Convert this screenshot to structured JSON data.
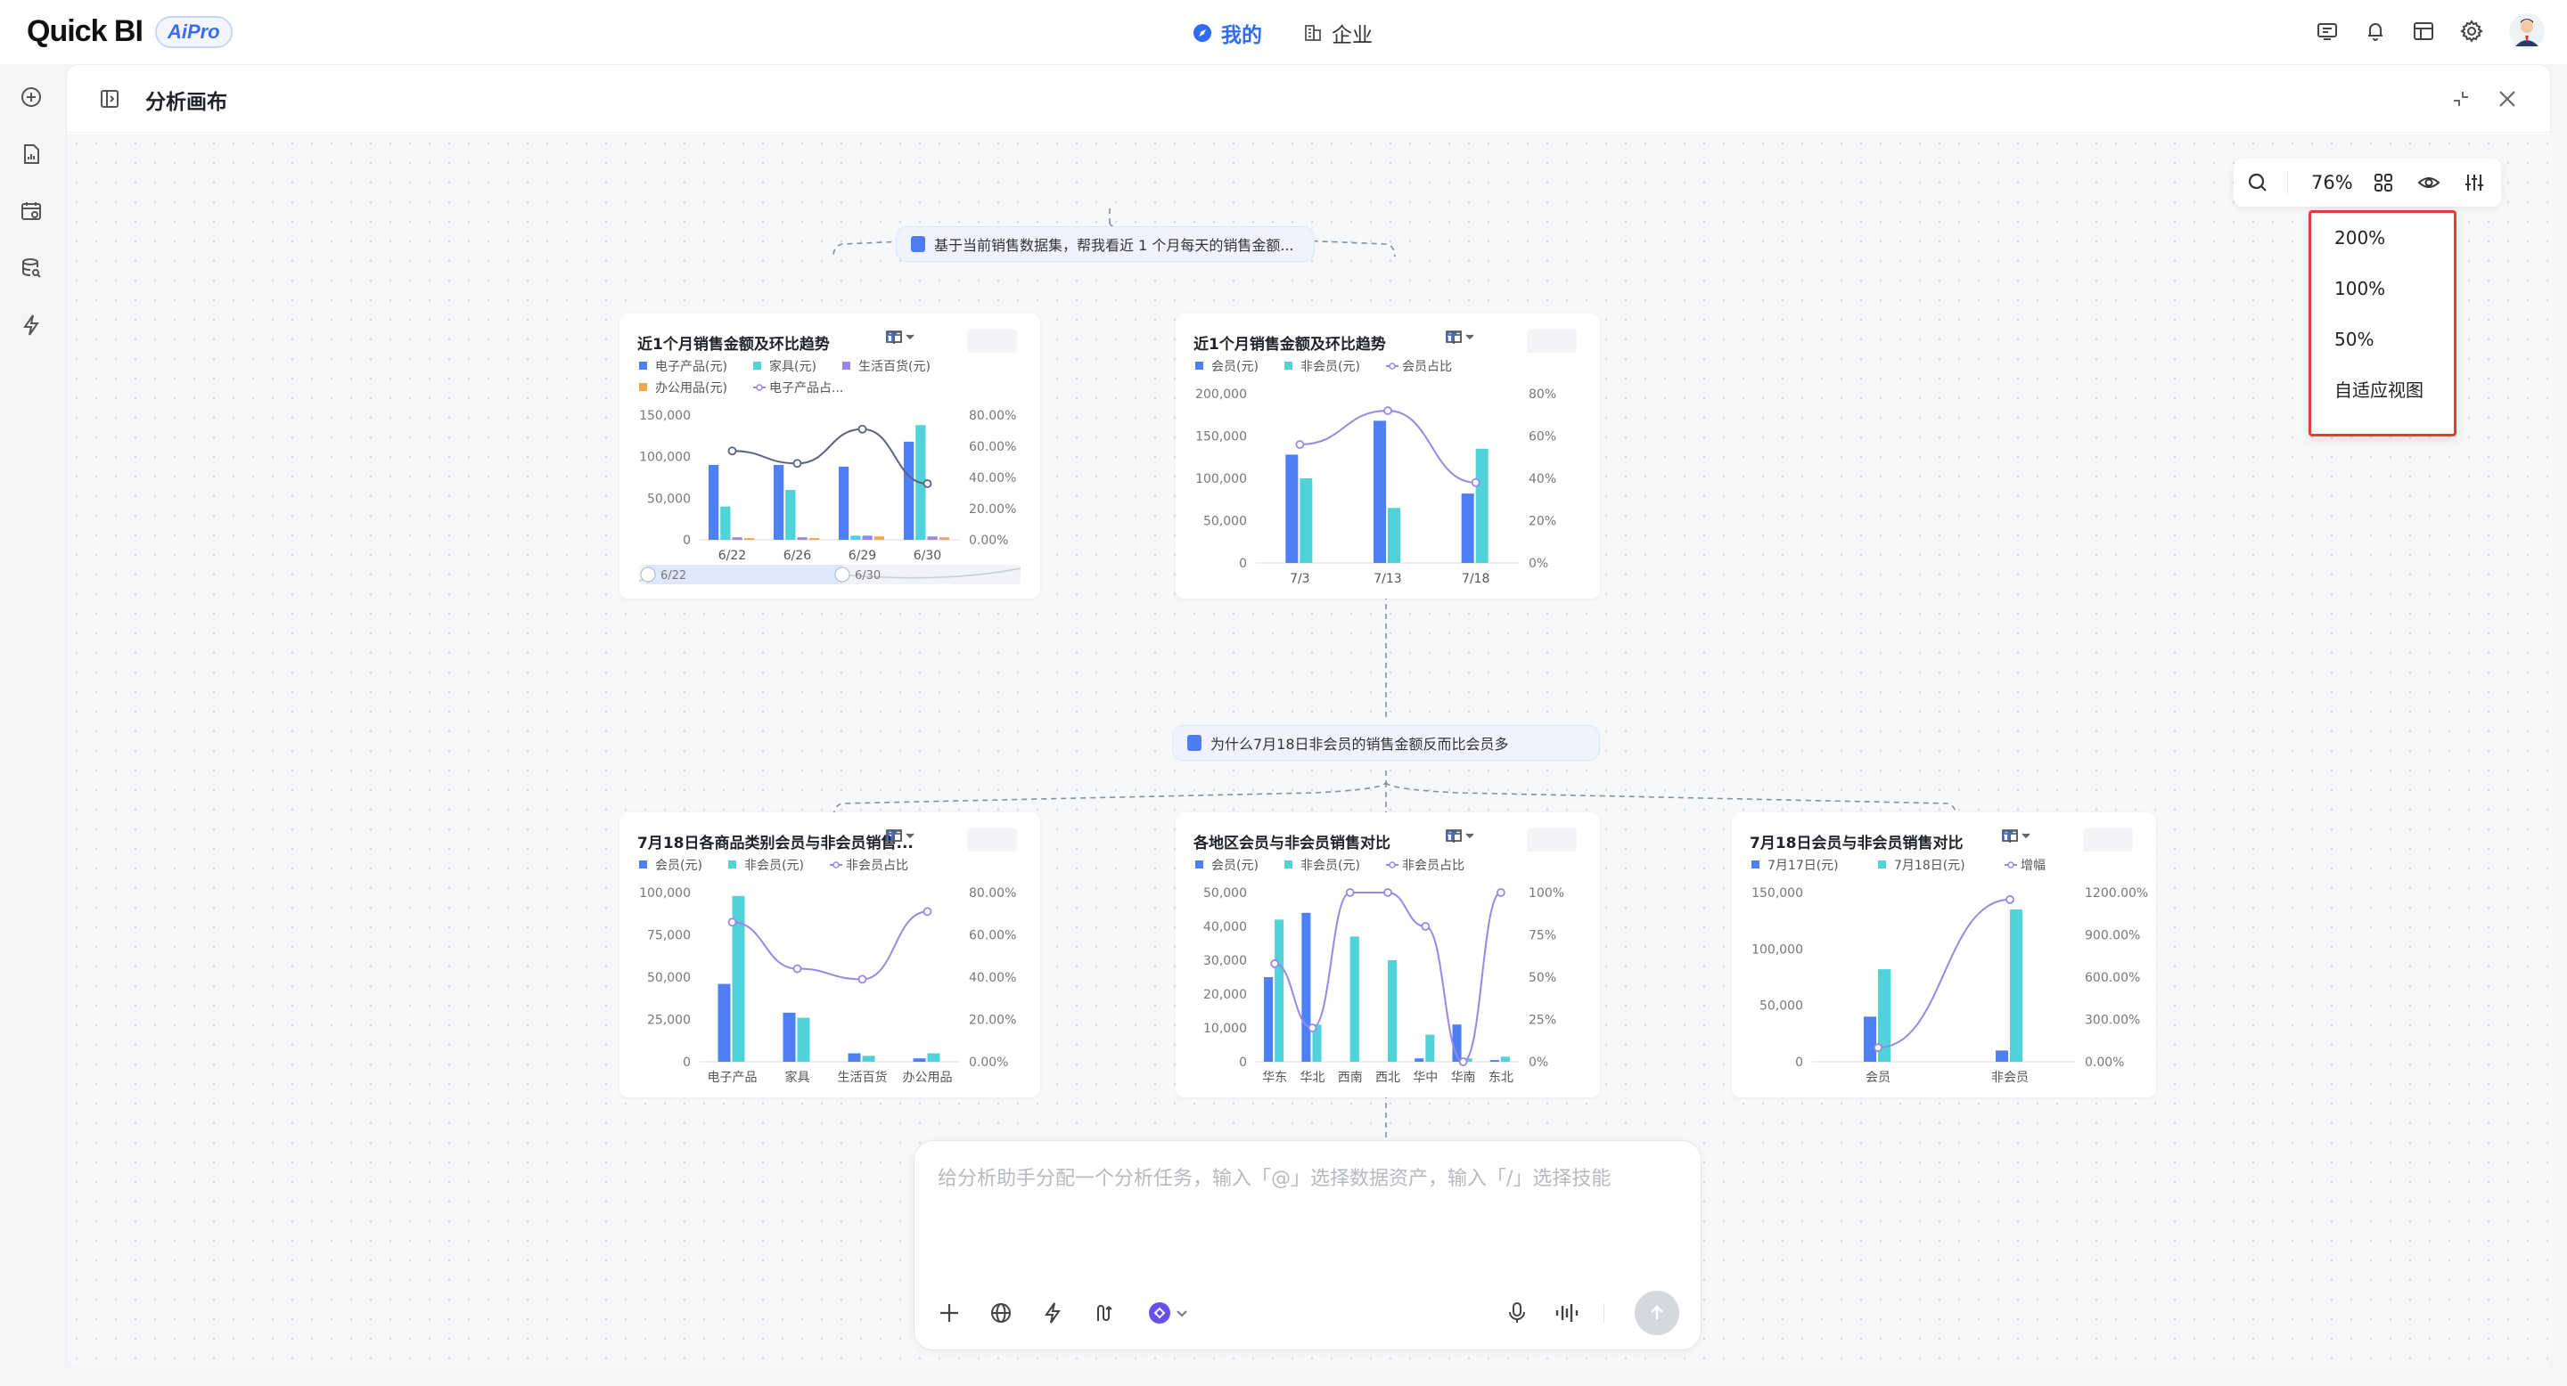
{
  "app": {
    "logo": "Quick BI",
    "badge": "AiPro"
  },
  "nav": {
    "mine": "我的",
    "enterprise": "企业"
  },
  "panel": {
    "title": "分析画布"
  },
  "questions": {
    "q1": "基于当前销售数据集，帮我看近 1 个月每天的销售金额...",
    "q2": "为什么7月18日非会员的销售金额反而比会员多"
  },
  "toolbar": {
    "zoom": "76%"
  },
  "zoom_menu": [
    "200%",
    "100%",
    "50%",
    "自适应视图"
  ],
  "chat": {
    "placeholder": "给分析助手分配一个分析任务，输入「@」选择数据资产，输入「/」选择技能"
  },
  "colors": {
    "blue": "#4e7ff5",
    "cyan": "#4fd3d9",
    "purple": "#9b86e8",
    "orange": "#f5a54a",
    "accent": "#2f6bf6"
  },
  "chart_data": [
    {
      "type": "bar",
      "title": "近1个月销售金额及环比趋势",
      "categories": [
        "6/22",
        "6/26",
        "6/29",
        "6/30"
      ],
      "legend": [
        "电子产品(元)",
        "家具(元)",
        "生活百货(元)",
        "办公用品(元)",
        "电子产品占..."
      ],
      "yticks": [
        "150,000",
        "100,000",
        "50,000",
        "0"
      ],
      "y2ticks": [
        "80.00%",
        "60.00%",
        "40.00%",
        "20.00%",
        "0.00%"
      ],
      "ylim": [
        0,
        150000
      ],
      "y2lim": [
        0,
        80
      ],
      "series": [
        {
          "name": "电子产品(元)",
          "values": [
            90000,
            90000,
            88000,
            118000
          ]
        },
        {
          "name": "家具(元)",
          "values": [
            40000,
            60000,
            5000,
            138000
          ]
        },
        {
          "name": "生活百货(元)",
          "values": [
            3000,
            3000,
            5000,
            4000
          ]
        },
        {
          "name": "办公用品(元)",
          "values": [
            2000,
            2000,
            4000,
            3000
          ]
        },
        {
          "name": "电子产品占...",
          "line": true,
          "values": [
            57,
            49,
            71,
            36
          ]
        }
      ],
      "slider": {
        "start": "6/22",
        "end": "6/30"
      }
    },
    {
      "type": "bar",
      "title": "近1个月销售金额及环比趋势",
      "categories": [
        "7/3",
        "7/13",
        "7/18"
      ],
      "legend": [
        "会员(元)",
        "非会员(元)",
        "会员占比"
      ],
      "yticks": [
        "200,000",
        "150,000",
        "100,000",
        "50,000",
        "0"
      ],
      "y2ticks": [
        "80%",
        "60%",
        "40%",
        "20%",
        "0%"
      ],
      "ylim": [
        0,
        200000
      ],
      "y2lim": [
        0,
        80
      ],
      "series": [
        {
          "name": "会员(元)",
          "values": [
            128000,
            168000,
            82000
          ]
        },
        {
          "name": "非会员(元)",
          "values": [
            100000,
            65000,
            135000
          ]
        },
        {
          "name": "会员占比",
          "line": true,
          "values": [
            56,
            72,
            38
          ]
        }
      ]
    },
    {
      "type": "bar",
      "title": "7月18日各商品类别会员与非会员销售...",
      "categories": [
        "电子产品",
        "家具",
        "生活百货",
        "办公用品"
      ],
      "legend": [
        "会员(元)",
        "非会员(元)",
        "非会员占比"
      ],
      "yticks": [
        "100,000",
        "75,000",
        "50,000",
        "25,000",
        "0"
      ],
      "y2ticks": [
        "80.00%",
        "60.00%",
        "40.00%",
        "20.00%",
        "0.00%"
      ],
      "ylim": [
        0,
        100000
      ],
      "y2lim": [
        0,
        80
      ],
      "series": [
        {
          "name": "会员(元)",
          "values": [
            46000,
            29000,
            5000,
            2000
          ]
        },
        {
          "name": "非会员(元)",
          "values": [
            98000,
            26000,
            3500,
            5000
          ]
        },
        {
          "name": "非会员占比",
          "line": true,
          "values": [
            66,
            44,
            39,
            71
          ]
        }
      ]
    },
    {
      "type": "bar",
      "title": "各地区会员与非会员销售对比",
      "categories": [
        "华东",
        "华北",
        "西南",
        "西北",
        "华中",
        "华南",
        "东北"
      ],
      "legend": [
        "会员(元)",
        "非会员(元)",
        "非会员占比"
      ],
      "yticks": [
        "50,000",
        "40,000",
        "30,000",
        "20,000",
        "10,000",
        "0"
      ],
      "y2ticks": [
        "100%",
        "75%",
        "50%",
        "25%",
        "0%"
      ],
      "ylim": [
        0,
        50000
      ],
      "y2lim": [
        0,
        100
      ],
      "series": [
        {
          "name": "会员(元)",
          "values": [
            25000,
            44000,
            0,
            0,
            1000,
            11000,
            500
          ]
        },
        {
          "name": "非会员(元)",
          "values": [
            42000,
            11000,
            37000,
            30000,
            8000,
            1000,
            1500
          ]
        },
        {
          "name": "非会员占比",
          "line": true,
          "values": [
            58,
            20,
            100,
            100,
            80,
            0,
            100
          ]
        }
      ]
    },
    {
      "type": "bar",
      "title": "7月18日会员与非会员销售对比",
      "categories": [
        "会员",
        "非会员"
      ],
      "legend": [
        "7月17日(元)",
        "7月18日(元)",
        "增幅"
      ],
      "yticks": [
        "150,000",
        "100,000",
        "50,000",
        "0"
      ],
      "y2ticks": [
        "1200.00%",
        "900.00%",
        "600.00%",
        "300.00%",
        "0.00%"
      ],
      "ylim": [
        0,
        150000
      ],
      "y2lim": [
        0,
        1200
      ],
      "series": [
        {
          "name": "7月17日(元)",
          "values": [
            40000,
            10000
          ]
        },
        {
          "name": "7月18日(元)",
          "values": [
            82000,
            135000
          ]
        },
        {
          "name": "增幅",
          "line": true,
          "values": [
            100,
            1150
          ]
        }
      ]
    }
  ]
}
